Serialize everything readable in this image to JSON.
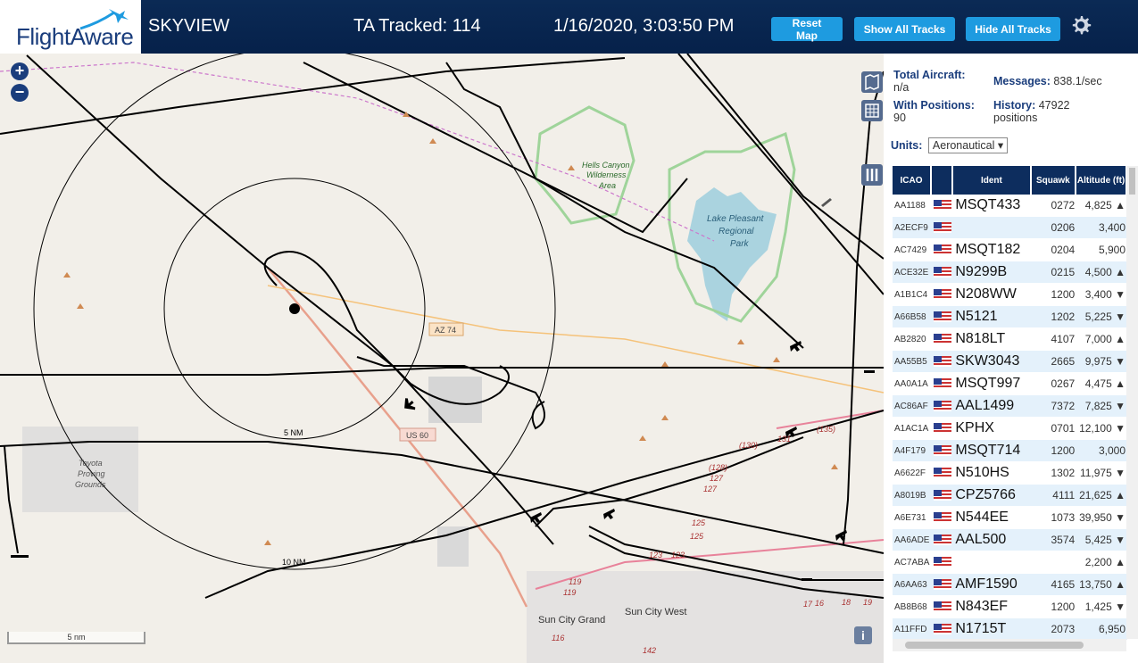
{
  "header": {
    "logo_text": "FlightAware",
    "site_name": "SKYVIEW",
    "tracked": "TA Tracked: 114",
    "datetime": "1/16/2020, 3:03:50 PM",
    "reset_label": "Reset Map",
    "show_label": "Show All Tracks",
    "hide_label": "Hide All Tracks"
  },
  "map": {
    "zoom_in": "+",
    "zoom_out": "−",
    "scale_label": "5 nm",
    "info_label": "i",
    "labels": {
      "ring5": "5 NM",
      "ring10": "10 NM",
      "az74": "AZ 74",
      "us60": "US 60",
      "lake": "Lake Pleasant",
      "regional": "Regional",
      "park": "Park",
      "hells1": "Hells Canyon",
      "hells2": "Wilderness",
      "hells3": "Area",
      "toyota1": "Toyota",
      "toyota2": "Proving",
      "toyota3": "Grounds",
      "suncitygrand": "Sun City Grand",
      "suncitywest": "Sun City West",
      "r130": "(130)",
      "r135": "(135)",
      "r131": "131",
      "r128": "(128)",
      "r127a": "127",
      "r127b": "127",
      "r125a": "125",
      "r125b": "125",
      "r123a": "123",
      "r123b": "123",
      "r119a": "119",
      "r119b": "119",
      "r116": "116",
      "r142": "142",
      "r17": "17",
      "r16": "16",
      "r18": "18",
      "r19": "19"
    }
  },
  "panel": {
    "total_label": "Total Aircraft:",
    "total_value": "n/a",
    "messages_label": "Messages:",
    "messages_value": "838.1/sec",
    "positions_label": "With Positions:",
    "positions_value": "90",
    "history_label": "History:",
    "history_value": "47922",
    "history_unit": "positions",
    "units_label": "Units:",
    "units_value": "Aeronautical",
    "columns": [
      "ICAO",
      "",
      "Ident",
      "Squawk",
      "Altitude (ft)"
    ],
    "rows": [
      {
        "icao": "AA1188",
        "ident": "MSQT433",
        "squawk": "0272",
        "alt": "4,825 ▲"
      },
      {
        "icao": "A2ECF9",
        "ident": "",
        "squawk": "0206",
        "alt": "3,400"
      },
      {
        "icao": "AC7429",
        "ident": "MSQT182",
        "squawk": "0204",
        "alt": "5,900"
      },
      {
        "icao": "ACE32E",
        "ident": "N9299B",
        "squawk": "0215",
        "alt": "4,500 ▲"
      },
      {
        "icao": "A1B1C4",
        "ident": "N208WW",
        "squawk": "1200",
        "alt": "3,400 ▼"
      },
      {
        "icao": "A66B58",
        "ident": "N5121",
        "squawk": "1202",
        "alt": "5,225 ▼"
      },
      {
        "icao": "AB2820",
        "ident": "N818LT",
        "squawk": "4107",
        "alt": "7,000 ▲"
      },
      {
        "icao": "AA55B5",
        "ident": "SKW3043",
        "squawk": "2665",
        "alt": "9,975 ▼"
      },
      {
        "icao": "AA0A1A",
        "ident": "MSQT997",
        "squawk": "0267",
        "alt": "4,475 ▲"
      },
      {
        "icao": "AC86AF",
        "ident": "AAL1499",
        "squawk": "7372",
        "alt": "7,825 ▼"
      },
      {
        "icao": "A1AC1A",
        "ident": "KPHX",
        "squawk": "0701",
        "alt": "12,100 ▼"
      },
      {
        "icao": "A4F179",
        "ident": "MSQT714",
        "squawk": "1200",
        "alt": "3,000"
      },
      {
        "icao": "A6622F",
        "ident": "N510HS",
        "squawk": "1302",
        "alt": "11,975 ▼"
      },
      {
        "icao": "A8019B",
        "ident": "CPZ5766",
        "squawk": "4111",
        "alt": "21,625 ▲"
      },
      {
        "icao": "A6E731",
        "ident": "N544EE",
        "squawk": "1073",
        "alt": "39,950 ▼"
      },
      {
        "icao": "AA6ADE",
        "ident": "AAL500",
        "squawk": "3574",
        "alt": "5,425 ▼"
      },
      {
        "icao": "AC7ABA",
        "ident": "",
        "squawk": "",
        "alt": "2,200 ▲"
      },
      {
        "icao": "A6AA63",
        "ident": "AMF1590",
        "squawk": "4165",
        "alt": "13,750 ▲"
      },
      {
        "icao": "AB8B68",
        "ident": "N843EF",
        "squawk": "1200",
        "alt": "1,425 ▼"
      },
      {
        "icao": "A11FFD",
        "ident": "N1715T",
        "squawk": "2073",
        "alt": "6,950"
      }
    ]
  }
}
